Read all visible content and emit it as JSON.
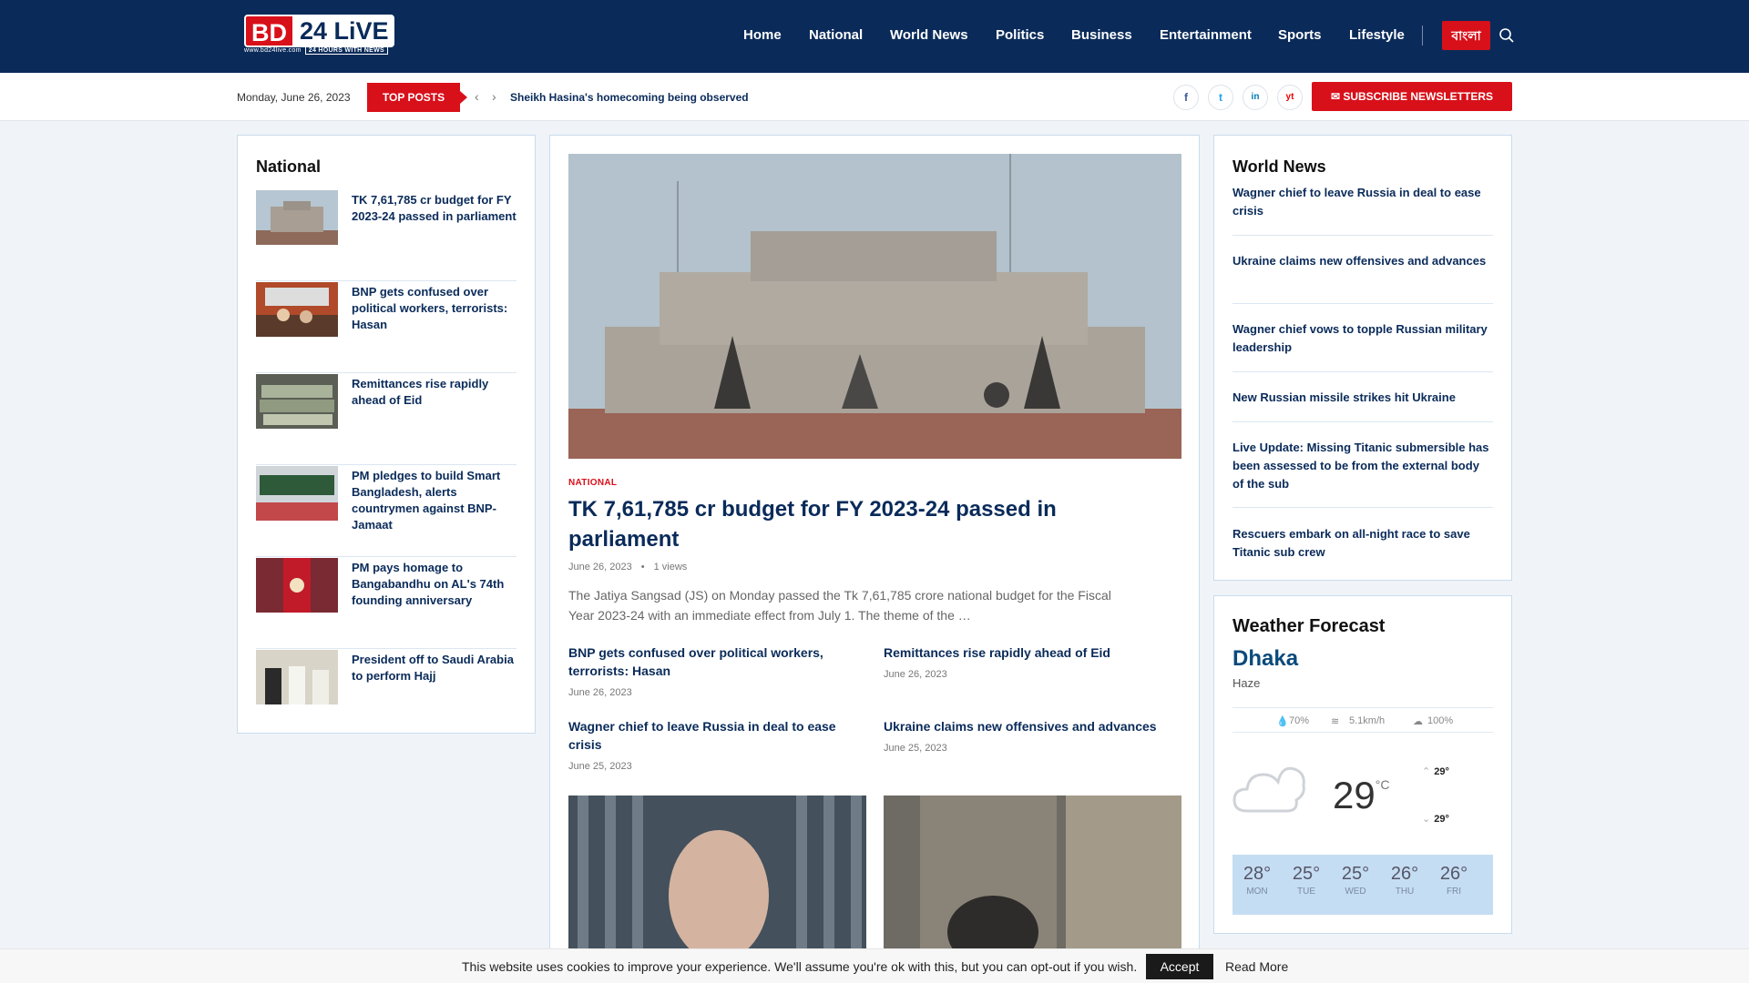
{
  "logo": {
    "part1": "BD",
    "part2": "24 LiVE",
    "url": "www.bd24live.com",
    "tagline": "24 HOURS WITH NEWS"
  },
  "nav": {
    "items": [
      "Home",
      "National",
      "World News",
      "Politics",
      "Business",
      "Entertainment",
      "Sports",
      "Lifestyle"
    ],
    "lang_button": "বাংলা"
  },
  "subbar": {
    "date": "Monday, June 26, 2023",
    "top_posts_label": "TOP POSTS",
    "ticker": "Sheikh Hasina's homecoming being observed",
    "social": [
      "f",
      "t",
      "in",
      "yt"
    ],
    "subscribe": "✉ SUBSCRIBE NEWSLETTERS"
  },
  "national": {
    "heading": "National",
    "items": [
      "TK 7,61,785 cr budget for FY 2023-24 passed in parliament",
      "BNP gets confused over political workers, terrorists: Hasan",
      "Remittances rise rapidly ahead of Eid",
      "PM pledges to build Smart Bangladesh, alerts countrymen against BNP-Jamaat",
      "PM pays homage to Bangabandhu on AL's 74th founding anniversary",
      "President off to Saudi Arabia to perform Hajj"
    ]
  },
  "featured": {
    "category": "NATIONAL",
    "title": "TK 7,61,785 cr budget for FY 2023-24 passed in parliament",
    "date": "June 26, 2023",
    "views": "1 views",
    "excerpt": "The Jatiya Sangsad (JS) on Monday passed the Tk 7,61,785 crore national budget for the Fiscal Year 2023-24 with an immediate effect from July 1. The theme of the …",
    "sub": [
      {
        "title": "BNP gets confused over political workers, terrorists: Hasan",
        "date": "June 26, 2023"
      },
      {
        "title": "Remittances rise rapidly ahead of Eid",
        "date": "June 26, 2023"
      },
      {
        "title": "Wagner chief to leave Russia in deal to ease crisis",
        "date": "June 25, 2023"
      },
      {
        "title": "Ukraine claims new offensives and advances",
        "date": "June 25, 2023"
      }
    ]
  },
  "world": {
    "heading": "World News",
    "items": [
      "Wagner chief to leave Russia in deal to ease crisis",
      "Ukraine claims new offensives and advances",
      "Wagner chief vows to topple Russian military leadership",
      "New Russian missile strikes hit Ukraine",
      "Live Update: Missing Titanic submersible has been assessed to be from the external body of the sub",
      "Rescuers embark on all-night race to save Titanic sub crew"
    ]
  },
  "weather": {
    "heading": "Weather Forecast",
    "city": "Dhaka",
    "condition": "Haze",
    "humidity": "70%",
    "wind": "5.1km/h",
    "clouds": "100%",
    "temp": "29",
    "unit": "°C",
    "high": "29°",
    "low": "29°",
    "forecast": [
      {
        "t": "28°",
        "d": "MON"
      },
      {
        "t": "25°",
        "d": "TUE"
      },
      {
        "t": "25°",
        "d": "WED"
      },
      {
        "t": "26°",
        "d": "THU"
      },
      {
        "t": "26°",
        "d": "FRI"
      }
    ]
  },
  "cookie": {
    "message": "This website uses cookies to improve your experience. We'll assume you're ok with this, but you can opt-out if you wish.",
    "accept": "Accept",
    "read_more": "Read More"
  }
}
